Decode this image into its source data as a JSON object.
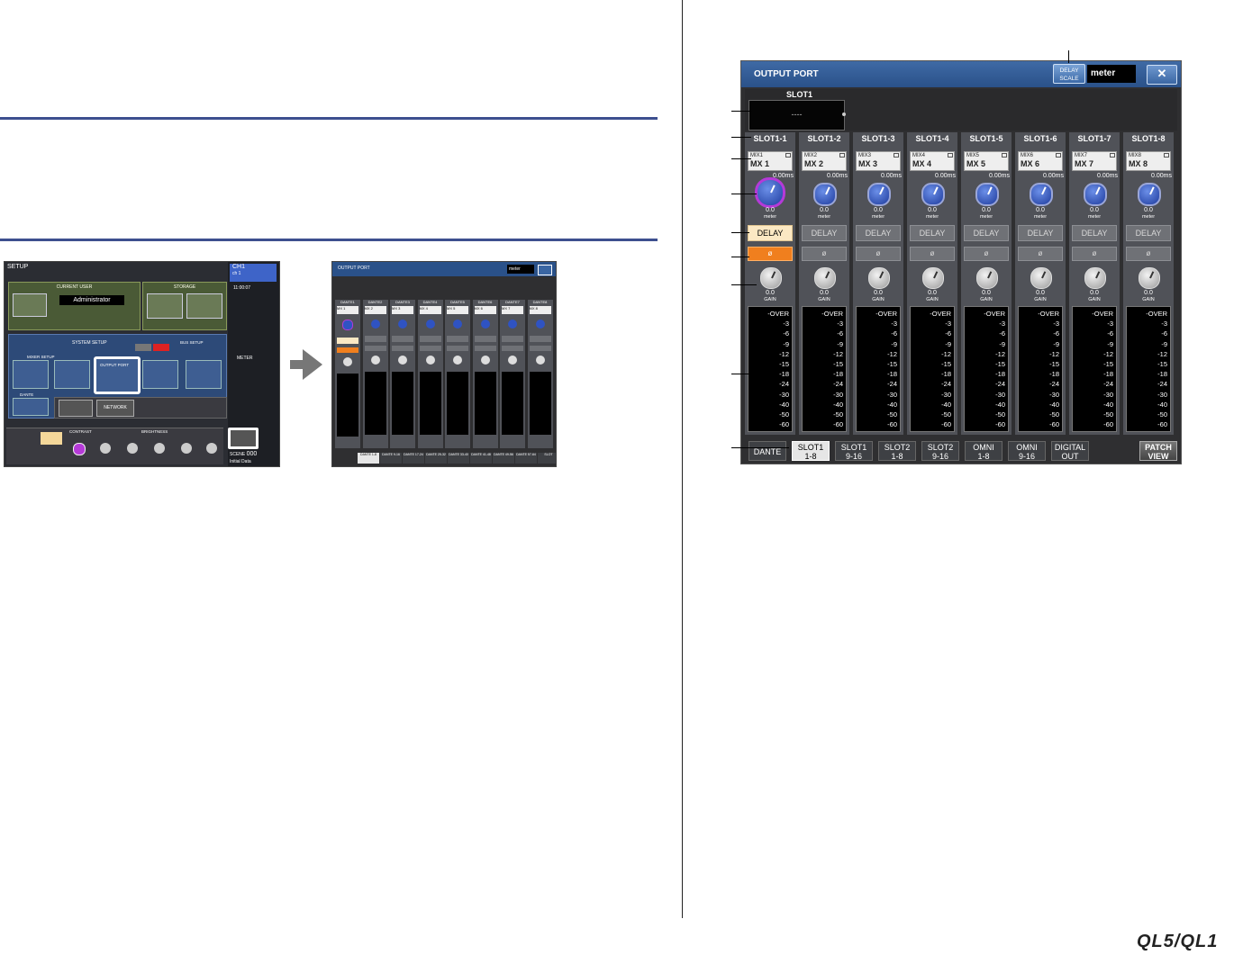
{
  "logo": "QL5/QL1",
  "output_port": {
    "title": "OUTPUT PORT",
    "delay_scale_label": "DELAY SCALE",
    "delay_scale_value": "meter",
    "close_label": "✕",
    "slot_label": "SLOT1",
    "slot_value": "----",
    "channels": [
      {
        "name": "SLOT1-1",
        "patch_small": "MIX1",
        "patch": "MX 1",
        "delay": "0.00ms",
        "delay_val": "0.0",
        "unit": "meter",
        "gain": "0.0",
        "gain_label": "GAIN",
        "delay_label": "DELAY",
        "phase": "ø",
        "delay_on": true,
        "phase_on": true,
        "active": true
      },
      {
        "name": "SLOT1-2",
        "patch_small": "MIX2",
        "patch": "MX 2",
        "delay": "0.00ms",
        "delay_val": "0.0",
        "unit": "meter",
        "gain": "0.0",
        "gain_label": "GAIN",
        "delay_label": "DELAY",
        "phase": "ø"
      },
      {
        "name": "SLOT1-3",
        "patch_small": "MIX3",
        "patch": "MX 3",
        "delay": "0.00ms",
        "delay_val": "0.0",
        "unit": "meter",
        "gain": "0.0",
        "gain_label": "GAIN",
        "delay_label": "DELAY",
        "phase": "ø"
      },
      {
        "name": "SLOT1-4",
        "patch_small": "MIX4",
        "patch": "MX 4",
        "delay": "0.00ms",
        "delay_val": "0.0",
        "unit": "meter",
        "gain": "0.0",
        "gain_label": "GAIN",
        "delay_label": "DELAY",
        "phase": "ø"
      },
      {
        "name": "SLOT1-5",
        "patch_small": "MIX5",
        "patch": "MX 5",
        "delay": "0.00ms",
        "delay_val": "0.0",
        "unit": "meter",
        "gain": "0.0",
        "gain_label": "GAIN",
        "delay_label": "DELAY",
        "phase": "ø"
      },
      {
        "name": "SLOT1-6",
        "patch_small": "MIX6",
        "patch": "MX 6",
        "delay": "0.00ms",
        "delay_val": "0.0",
        "unit": "meter",
        "gain": "0.0",
        "gain_label": "GAIN",
        "delay_label": "DELAY",
        "phase": "ø"
      },
      {
        "name": "SLOT1-7",
        "patch_small": "MIX7",
        "patch": "MX 7",
        "delay": "0.00ms",
        "delay_val": "0.0",
        "unit": "meter",
        "gain": "0.0",
        "gain_label": "GAIN",
        "delay_label": "DELAY",
        "phase": "ø"
      },
      {
        "name": "SLOT1-8",
        "patch_small": "MIX8",
        "patch": "MX 8",
        "delay": "0.00ms",
        "delay_val": "0.0",
        "unit": "meter",
        "gain": "0.0",
        "gain_label": "GAIN",
        "delay_label": "DELAY",
        "phase": "ø"
      }
    ],
    "meter_scale": [
      "-OVER",
      "-3",
      "-6",
      "-9",
      "-12",
      "-15",
      "-18",
      "-24",
      "-30",
      "-40",
      "-50",
      "-60"
    ],
    "tabs": [
      {
        "l1": "DANTE",
        "l2": ""
      },
      {
        "l1": "SLOT1",
        "l2": "1-8"
      },
      {
        "l1": "SLOT1",
        "l2": "9-16"
      },
      {
        "l1": "SLOT2",
        "l2": "1-8"
      },
      {
        "l1": "SLOT2",
        "l2": "9-16"
      },
      {
        "l1": "OMNI",
        "l2": "1-8"
      },
      {
        "l1": "OMNI",
        "l2": "9-16"
      },
      {
        "l1": "DIGITAL",
        "l2": "OUT"
      }
    ],
    "patch_view": {
      "l1": "PATCH",
      "l2": "VIEW"
    }
  },
  "setup_thumb": {
    "title": "SETUP",
    "current_user": "CURRENT USER",
    "storage": "STORAGE",
    "user_name": "Administrator",
    "system_setup": "SYSTEM SETUP",
    "mixer_setup": "MIXER SETUP",
    "bus_setup": "BUS SETUP",
    "output_port_btn": "OUTPUT PORT",
    "dante": "DANTE",
    "network": "NETWORK",
    "brightness": "BRIGHTNESS",
    "contrast": "CONTRAST",
    "ch": "CH1",
    "ch_name": "ch 1",
    "time": "11:00:07",
    "meter": "METER",
    "scene": "SCENE",
    "scene_num": "000",
    "scene_name": "Initial Data"
  },
  "output_thumb": {
    "title": "OUTPUT PORT",
    "scale_value": "meter",
    "channels": [
      "DANTE1",
      "DANTE2",
      "DANTE3",
      "DANTE4",
      "DANTE5",
      "DANTE6",
      "DANTE7",
      "DANTE8"
    ],
    "patches": [
      "MX 1",
      "MX 2",
      "MX 3",
      "MX 4",
      "MX 5",
      "MX 6",
      "MX 7",
      "MX 8"
    ],
    "tabs": [
      "DANTE 1-8",
      "DANTE 9-16",
      "DANTE 17-24",
      "DANTE 25-32",
      "DANTE 33-40",
      "DANTE 41-48",
      "DANTE 49-56",
      "DANTE 57-64",
      "SLOT"
    ]
  }
}
